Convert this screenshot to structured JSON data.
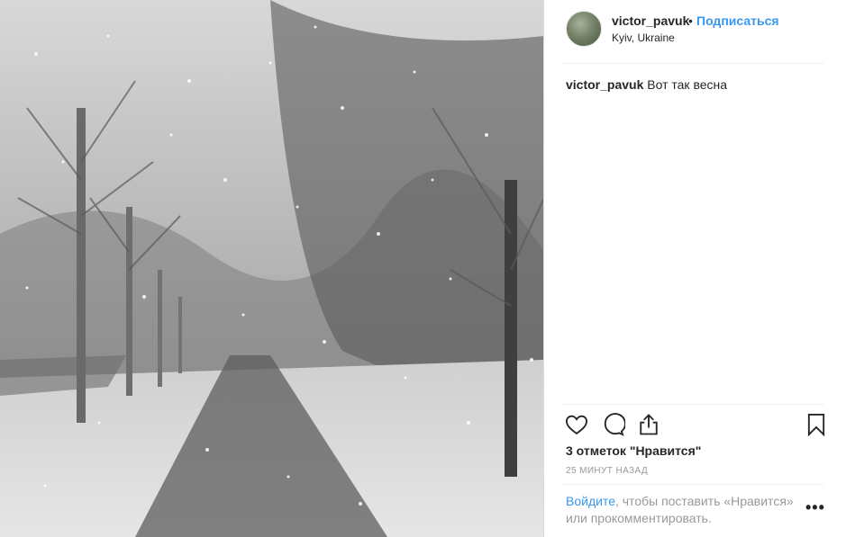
{
  "post": {
    "image_alt": "snowy tree-lined path"
  },
  "header": {
    "username": "victor_pavuk",
    "separator": "•",
    "follow_label": "Подписаться",
    "location": "Kyiv, Ukraine"
  },
  "caption": {
    "username": "victor_pavuk",
    "text": "Вот так весна"
  },
  "actions": {
    "like_icon": "heart-icon",
    "comment_icon": "comment-bubble-icon",
    "share_icon": "share-icon",
    "save_icon": "bookmark-icon"
  },
  "stats": {
    "likes": "3 отметок \"Нравится\"",
    "time": "25 МИНУТ НАЗАД"
  },
  "footer": {
    "login_link": "Войдите",
    "login_text": ", чтобы поставить «Нравится» или прокомментировать.",
    "more_label": "•••"
  },
  "colors": {
    "accent": "#3897f0",
    "muted": "#999999",
    "text": "#262626"
  }
}
